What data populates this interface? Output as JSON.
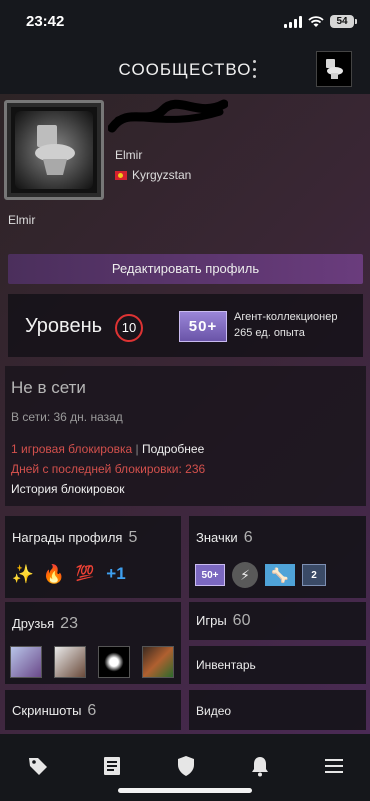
{
  "status_bar": {
    "time": "23:42",
    "battery": "54"
  },
  "header": {
    "title": "СООБЩЕСТВО"
  },
  "profile": {
    "avatar_caption": "Elmir",
    "persona_name": "Elmir",
    "country": "Kyrgyzstan",
    "edit_button": "Редактировать профиль"
  },
  "level": {
    "label": "Уровень",
    "value": "10",
    "badge_text": "50+",
    "badge_name": "Агент-коллекционер",
    "badge_xp": "265 ед. опыта"
  },
  "status": {
    "state": "Не в сети",
    "last_online": "В сети: 36 дн. назад",
    "game_bans": "1 игровая блокировка",
    "separator": "|",
    "more_link": "Подробнее",
    "days_since_ban": "Дней с последней блокировки: 236",
    "ban_history": "История блокировок"
  },
  "tiles": {
    "awards": {
      "title": "Награды профиля",
      "count": "5",
      "icons": [
        "✨",
        "🔥",
        "💯",
        "+1"
      ]
    },
    "badges": {
      "title": "Значки",
      "count": "6",
      "icons": [
        "50+",
        "⚡",
        "🦴",
        "2"
      ]
    },
    "friends": {
      "title": "Друзья",
      "count": "23"
    },
    "games": {
      "title": "Игры",
      "count": "60"
    },
    "inventory": {
      "title": "Инвентарь"
    },
    "screenshots": {
      "title": "Скриншоты",
      "count": "6"
    },
    "videos": {
      "title": "Видео"
    }
  },
  "nav": [
    "tag-icon",
    "news-icon",
    "shield-icon",
    "bell-icon",
    "menu-icon"
  ]
}
